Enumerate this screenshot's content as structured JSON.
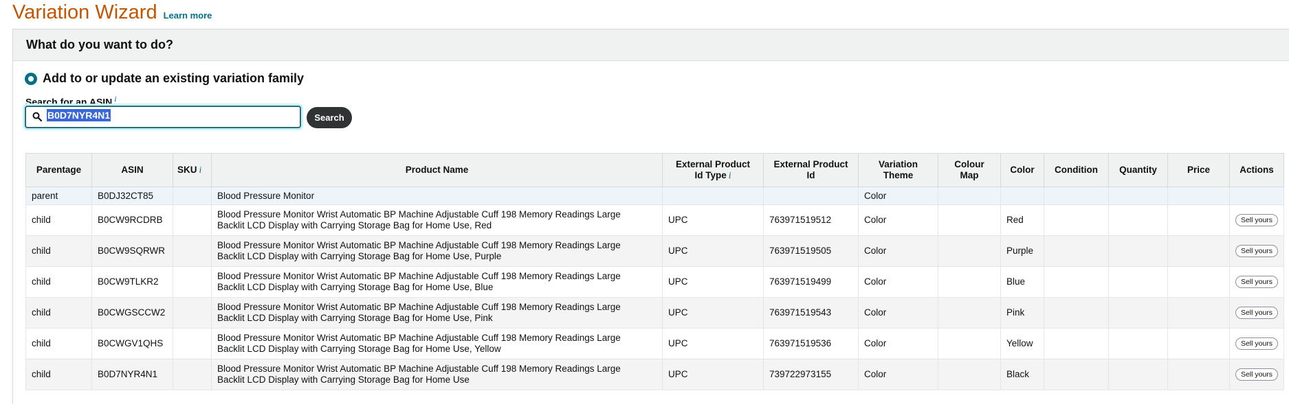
{
  "header": {
    "title": "Variation Wizard",
    "learn_more": "Learn more"
  },
  "section": {
    "question": "What do you want to do?"
  },
  "option": {
    "label": "Add to or update an existing variation family",
    "selected": true
  },
  "search": {
    "label": "Search for an ASIN",
    "info": "i",
    "value": "B0D7NYR4N1",
    "button": "Search"
  },
  "table": {
    "headers": {
      "parentage": "Parentage",
      "asin": "ASIN",
      "sku": "SKU",
      "sku_info": "i",
      "product_name": "Product Name",
      "ext_type_line1": "External Product",
      "ext_type_line2": "Id Type",
      "ext_type_info": "i",
      "ext_id_line1": "External Product",
      "ext_id_line2": "Id",
      "theme_line1": "Variation",
      "theme_line2": "Theme",
      "cmap_line1": "Colour",
      "cmap_line2": "Map",
      "color": "Color",
      "condition": "Condition",
      "quantity": "Quantity",
      "price": "Price",
      "actions": "Actions"
    },
    "rows": [
      {
        "parentage": "parent",
        "asin": "B0DJ32CT85",
        "name_line1": "Blood Pressure Monitor",
        "name_line2": "",
        "ext_type": "",
        "ext_id": "",
        "theme": "Color",
        "color": "",
        "action": ""
      },
      {
        "parentage": "child",
        "asin": "B0CW9RCDRB",
        "name_line1": "Blood Pressure Monitor Wrist Automatic BP Machine Adjustable Cuff 198 Memory Readings Large",
        "name_line2": "Backlit LCD Display with Carrying Storage Bag for Home Use, Red",
        "ext_type": "UPC",
        "ext_id": "763971519512",
        "theme": "Color",
        "color": "Red",
        "action": "Sell yours"
      },
      {
        "parentage": "child",
        "asin": "B0CW9SQRWR",
        "name_line1": "Blood Pressure Monitor Wrist Automatic BP Machine Adjustable Cuff 198 Memory Readings Large",
        "name_line2": "Backlit LCD Display with Carrying Storage Bag for Home Use, Purple",
        "ext_type": "UPC",
        "ext_id": "763971519505",
        "theme": "Color",
        "color": "Purple",
        "action": "Sell yours"
      },
      {
        "parentage": "child",
        "asin": "B0CW9TLKR2",
        "name_line1": "Blood Pressure Monitor Wrist Automatic BP Machine Adjustable Cuff 198 Memory Readings Large",
        "name_line2": "Backlit LCD Display with Carrying Storage Bag for Home Use, Blue",
        "ext_type": "UPC",
        "ext_id": "763971519499",
        "theme": "Color",
        "color": "Blue",
        "action": "Sell yours"
      },
      {
        "parentage": "child",
        "asin": "B0CWGSCCW2",
        "name_line1": "Blood Pressure Monitor Wrist Automatic BP Machine Adjustable Cuff 198 Memory Readings Large",
        "name_line2": "Backlit LCD Display with Carrying Storage Bag for Home Use, Pink",
        "ext_type": "UPC",
        "ext_id": "763971519543",
        "theme": "Color",
        "color": "Pink",
        "action": "Sell yours"
      },
      {
        "parentage": "child",
        "asin": "B0CWGV1QHS",
        "name_line1": "Blood Pressure Monitor Wrist Automatic BP Machine Adjustable Cuff 198 Memory Readings Large",
        "name_line2": "Backlit LCD Display with Carrying Storage Bag for Home Use, Yellow",
        "ext_type": "UPC",
        "ext_id": "763971519536",
        "theme": "Color",
        "color": "Yellow",
        "action": "Sell yours"
      },
      {
        "parentage": "child",
        "asin": "B0D7NYR4N1",
        "name_line1": "Blood Pressure Monitor Wrist Automatic BP Machine Adjustable Cuff 198 Memory Readings Large",
        "name_line2": "Backlit LCD Display with Carrying Storage Bag for Home Use",
        "ext_type": "UPC",
        "ext_id": "739722973155",
        "theme": "Color",
        "color": "Black",
        "action": "Sell yours"
      }
    ]
  },
  "colors": {
    "title": "#c45500",
    "link": "#007185",
    "header_bg": "#f0f2f2",
    "button_dark": "#303333",
    "selection": "#3a67d8"
  }
}
